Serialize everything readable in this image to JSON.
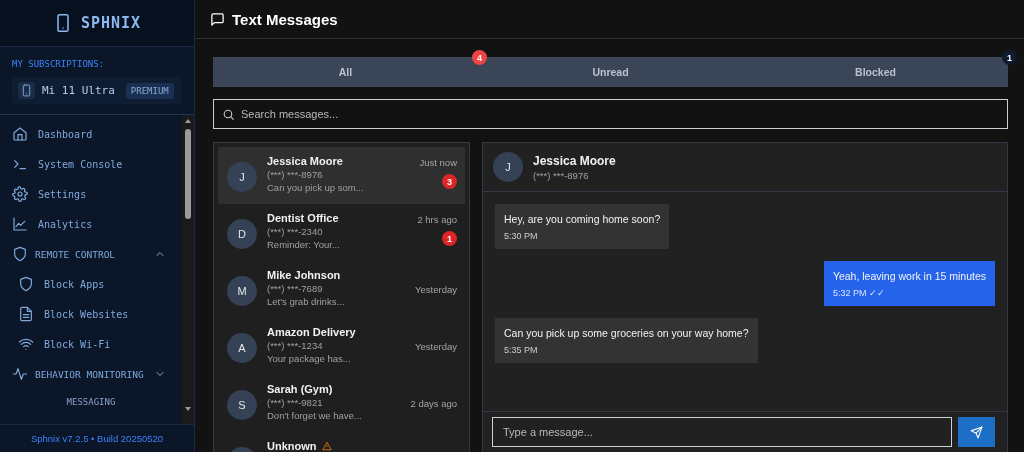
{
  "sidebar": {
    "brand": "SPHNIX",
    "subscriptions_label": "MY SUBSCRIPTIONS:",
    "device": {
      "name": "Mi 11 Ultra",
      "plan": "PREMIUM"
    },
    "nav": [
      {
        "kind": "item",
        "label": "Dashboard"
      },
      {
        "kind": "item",
        "label": "System Console"
      },
      {
        "kind": "item",
        "label": "Settings"
      },
      {
        "kind": "item",
        "label": "Analytics"
      },
      {
        "kind": "group",
        "label": "REMOTE CONTROL",
        "expanded": true,
        "children": [
          {
            "label": "Block Apps"
          },
          {
            "label": "Block Websites"
          },
          {
            "label": "Block Wi-Fi"
          }
        ]
      },
      {
        "kind": "group",
        "label": "BEHAVIOR MONITORING",
        "expanded": false
      },
      {
        "kind": "section",
        "label": "MESSAGING"
      }
    ],
    "footer": "Sphnix v7.2.5 • Build 20250520"
  },
  "main": {
    "title": "Text Messages",
    "tabs": [
      {
        "label": "All",
        "selected": false,
        "badge": {
          "text": "4",
          "color": "#ef4444"
        }
      },
      {
        "label": "Unread",
        "selected": false
      },
      {
        "label": "Blocked",
        "selected": false,
        "badge": {
          "text": "1",
          "color": "#0f1c30"
        }
      }
    ],
    "search": {
      "placeholder": "Search messages..."
    },
    "conversations": [
      {
        "initial": "J",
        "name": "Jessica Moore",
        "phone": "(***) ***-8976",
        "preview": "Can you pick up som...",
        "time": "Just now",
        "unread": "3",
        "selected": true,
        "flagged": false
      },
      {
        "initial": "D",
        "name": "Dentist Office",
        "phone": "(***) ***-2340",
        "preview": "Reminder: Your...",
        "time": "2 hrs ago",
        "unread": "1",
        "selected": false,
        "flagged": false
      },
      {
        "initial": "M",
        "name": "Mike Johnson",
        "phone": "(***) ***-7689",
        "preview": "Let's grab drinks...",
        "time": "Yesterday",
        "selected": false,
        "flagged": false
      },
      {
        "initial": "A",
        "name": "Amazon Delivery",
        "phone": "(***) ***-1234",
        "preview": "Your package has...",
        "time": "Yesterday",
        "selected": false,
        "flagged": false
      },
      {
        "initial": "S",
        "name": "Sarah (Gym)",
        "phone": "(***) ***-9821",
        "preview": "Don't forget we have...",
        "time": "2 days ago",
        "selected": false,
        "flagged": false
      },
      {
        "name": "Unknown",
        "selected": false,
        "flagged": true
      }
    ],
    "chat": {
      "contact": {
        "initial": "J",
        "name": "Jessica Moore",
        "phone": "(***) ***-8976"
      },
      "messages": [
        {
          "kind": "incoming",
          "text": "Hey, are you coming home soon?",
          "time": "5:30 PM"
        },
        {
          "kind": "outgoing",
          "text": "Yeah, leaving work in 15 minutes",
          "time": "5:32 PM",
          "status": "✓✓"
        },
        {
          "kind": "incoming",
          "text": "Can you pick up some groceries on your way home?",
          "time": "5:35 PM"
        }
      ],
      "composer": {
        "placeholder": "Type a message..."
      }
    }
  }
}
